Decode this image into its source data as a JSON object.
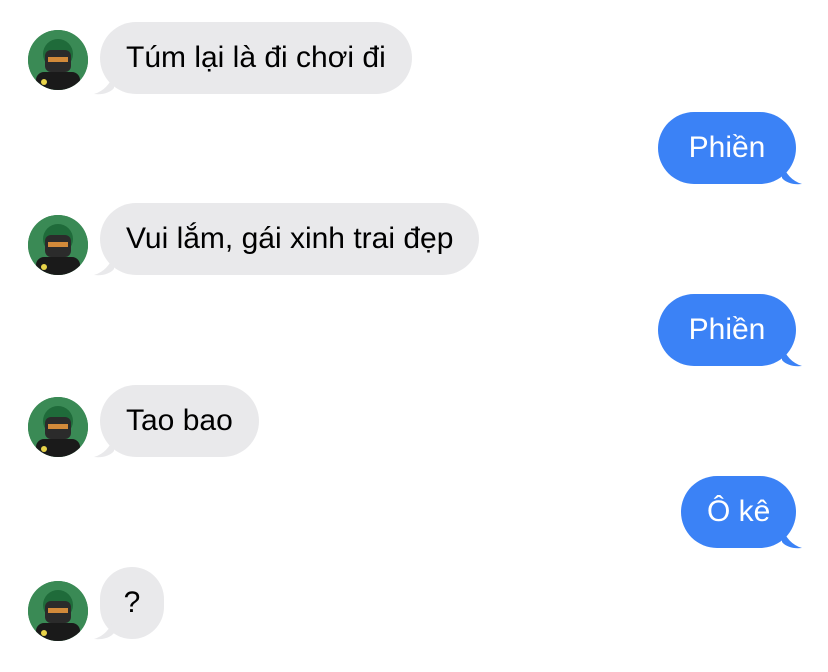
{
  "conversation": {
    "messages": [
      {
        "from": "other",
        "text": "Túm lại là đi chơi đi"
      },
      {
        "from": "me",
        "text": "Phiền"
      },
      {
        "from": "other",
        "text": "Vui lắm, gái xinh trai đẹp"
      },
      {
        "from": "me",
        "text": "Phiền"
      },
      {
        "from": "other",
        "text": "Tao bao"
      },
      {
        "from": "me",
        "text": "Ô kê"
      },
      {
        "from": "other",
        "text": "?"
      }
    ]
  },
  "colors": {
    "sent_bubble": "#3b82f6",
    "received_bubble": "#e9e9eb",
    "background": "#ffffff"
  },
  "icons": {
    "contact_avatar": "avatar-photo"
  }
}
